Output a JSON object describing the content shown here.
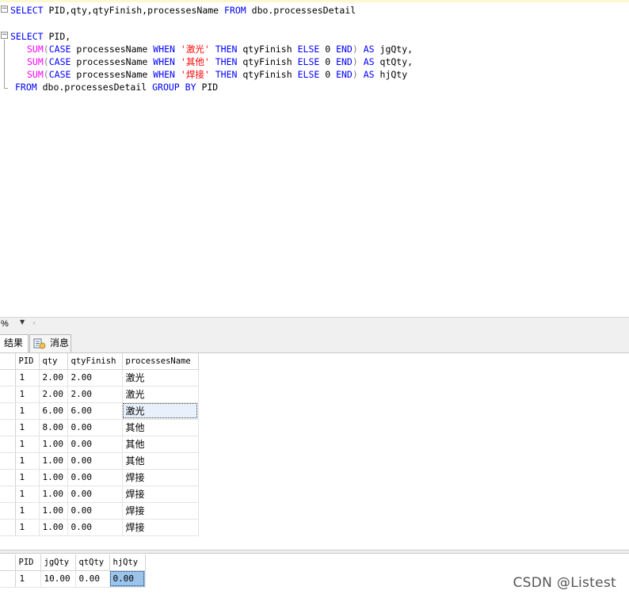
{
  "editor": {
    "line1": {
      "select": "SELECT",
      "cols": " PID,qty,qtyFinish,processesName ",
      "from": "FROM",
      "table": " dbo.processesDetail"
    },
    "line3": {
      "select": "SELECT",
      "rest": " PID,"
    },
    "sum_rows": [
      {
        "sum": "SUM",
        "open": "(",
        "case": "CASE",
        "col": " processesName ",
        "when": "WHEN",
        "str": "'激光'",
        "then": "THEN",
        "val": " qtyFinish ",
        "else": "ELSE",
        "zero": " 0 ",
        "end": "END",
        "close": ")",
        "as": "AS",
        "alias": " jgQty,"
      },
      {
        "sum": "SUM",
        "open": "(",
        "case": "CASE",
        "col": " processesName ",
        "when": "WHEN",
        "str": "'其他'",
        "then": "THEN",
        "val": " qtyFinish ",
        "else": "ELSE",
        "zero": " 0 ",
        "end": "END",
        "close": ")",
        "as": "AS",
        "alias": " qtQty,"
      },
      {
        "sum": "SUM",
        "open": "(",
        "case": "CASE",
        "col": " processesName ",
        "when": "WHEN",
        "str": "'焊接'",
        "then": "THEN",
        "val": " qtyFinish ",
        "else": "ELSE",
        "zero": " 0 ",
        "end": "END",
        "close": ")",
        "as": "AS",
        "alias": " hjQty"
      }
    ],
    "line7": {
      "from": "FROM",
      "table": " dbo.processesDetail ",
      "group": "GROUP",
      "by": "BY",
      "col": " PID"
    }
  },
  "zoom": {
    "value": "%"
  },
  "tabs": {
    "results": "结果",
    "messages": "消息"
  },
  "grid1": {
    "headers": [
      "PID",
      "qty",
      "qtyFinish",
      "processesName"
    ],
    "rows": [
      [
        "1",
        "2.00",
        "2.00",
        "激光"
      ],
      [
        "1",
        "2.00",
        "2.00",
        "激光"
      ],
      [
        "1",
        "6.00",
        "6.00",
        "激光"
      ],
      [
        "1",
        "8.00",
        "0.00",
        "其他"
      ],
      [
        "1",
        "1.00",
        "0.00",
        "其他"
      ],
      [
        "1",
        "1.00",
        "0.00",
        "其他"
      ],
      [
        "1",
        "1.00",
        "0.00",
        "焊接"
      ],
      [
        "1",
        "1.00",
        "0.00",
        "焊接"
      ],
      [
        "1",
        "1.00",
        "0.00",
        "焊接"
      ],
      [
        "1",
        "1.00",
        "0.00",
        "焊接"
      ]
    ]
  },
  "grid2": {
    "headers": [
      "PID",
      "jgQty",
      "qtQty",
      "hjQty"
    ],
    "rows": [
      [
        "1",
        "10.00",
        "0.00",
        "0.00"
      ]
    ]
  },
  "watermark": "CSDN @Listest"
}
